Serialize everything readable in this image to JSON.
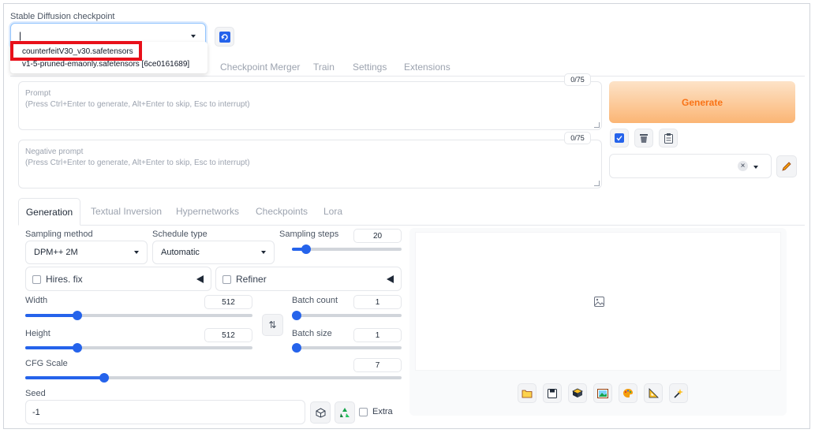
{
  "checkpoint": {
    "label": "Stable Diffusion checkpoint",
    "input_value": "|",
    "dropdown_options": [
      "counterfeitV30_v30.safetensors",
      "v1-5-pruned-emaonly.safetensors [6ce0161689]"
    ]
  },
  "top_tabs": [
    {
      "label": "Checkpoint Merger"
    },
    {
      "label": "Train"
    },
    {
      "label": "Settings"
    },
    {
      "label": "Extensions"
    }
  ],
  "prompt": {
    "label": "Prompt",
    "placeholder": "(Press Ctrl+Enter to generate, Alt+Enter to skip, Esc to interrupt)",
    "token_count": "0/75"
  },
  "negative_prompt": {
    "label": "Negative prompt",
    "placeholder": "(Press Ctrl+Enter to generate, Alt+Enter to skip, Esc to interrupt)",
    "token_count": "0/75"
  },
  "generate_label": "Generate",
  "sub_tabs": [
    {
      "label": "Generation"
    },
    {
      "label": "Textual Inversion"
    },
    {
      "label": "Hypernetworks"
    },
    {
      "label": "Checkpoints"
    },
    {
      "label": "Lora"
    }
  ],
  "generation": {
    "sampling_method": {
      "label": "Sampling method",
      "value": "DPM++ 2M"
    },
    "schedule_type": {
      "label": "Schedule type",
      "value": "Automatic"
    },
    "sampling_steps": {
      "label": "Sampling steps",
      "value": "20",
      "fraction": 0.13
    },
    "hires_fix": {
      "label": "Hires. fix"
    },
    "refiner": {
      "label": "Refiner"
    },
    "width": {
      "label": "Width",
      "value": "512",
      "fraction": 0.23
    },
    "height": {
      "label": "Height",
      "value": "512",
      "fraction": 0.23
    },
    "batch_count": {
      "label": "Batch count",
      "value": "1",
      "fraction": 0.0
    },
    "batch_size": {
      "label": "Batch size",
      "value": "1",
      "fraction": 0.0
    },
    "cfg_scale": {
      "label": "CFG Scale",
      "value": "7",
      "fraction": 0.21
    },
    "seed": {
      "label": "Seed",
      "value": "-1"
    },
    "extra_label": "Extra"
  },
  "colors": {
    "accent": "#2563eb",
    "generate_start": "#fdd9b5",
    "generate_end": "#fbb170",
    "generate_text": "#f97316",
    "highlight_red": "#e8101a"
  }
}
